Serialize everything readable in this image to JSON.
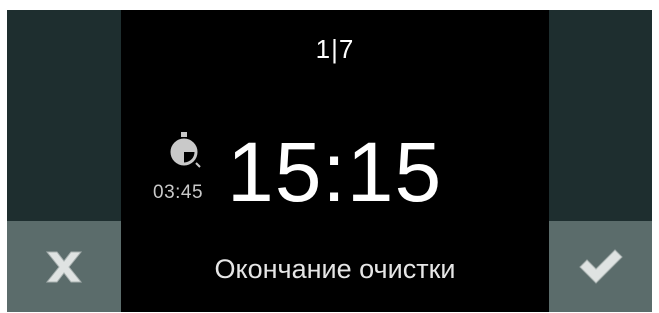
{
  "pagination": {
    "current": "1",
    "separator": "|",
    "total": "7"
  },
  "timer": {
    "icon": "timer-icon",
    "duration": "03:45"
  },
  "program": {
    "end_time": "15:15",
    "status": "Окончание очистки"
  },
  "controls": {
    "cancel_icon": "close-icon",
    "confirm_icon": "checkmark-icon"
  },
  "colors": {
    "background": "#000000",
    "side_panel_upper": "#1e2e2f",
    "side_panel_lower": "#5b6c6b",
    "text_primary": "#ffffff",
    "text_secondary": "#c9c9c9",
    "icon_light": "#dfe3e2"
  }
}
